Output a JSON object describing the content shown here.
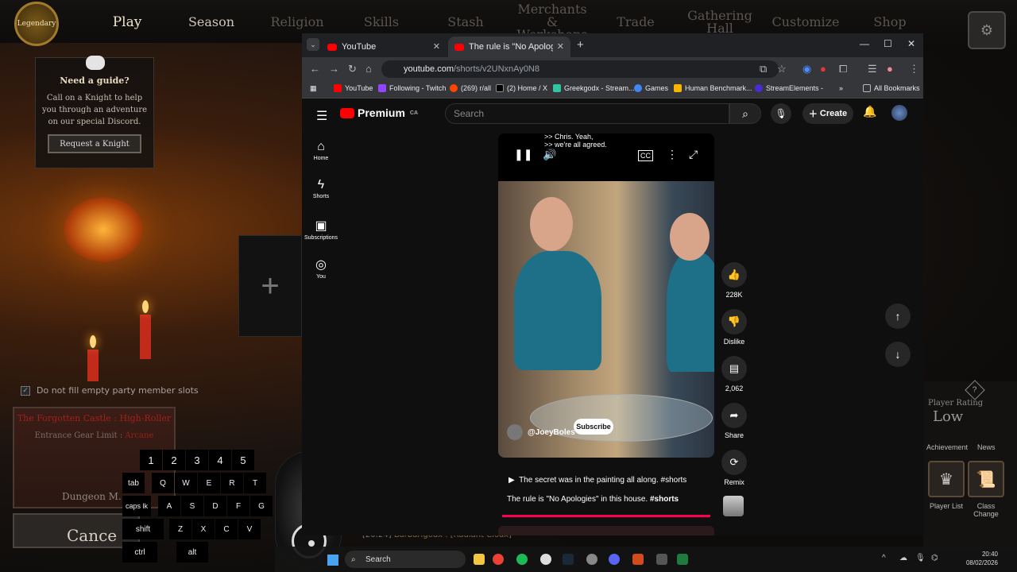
{
  "game": {
    "badge": "Legendary",
    "nav": [
      "Play",
      "Season",
      "Religion",
      "Skills",
      "Stash",
      "Merchants & Workshops",
      "Trade",
      "Gathering Hall",
      "Customize",
      "Shop"
    ],
    "guide_title": "Need a guide?",
    "guide_text": "Call on a Knight to help you through an adventure on our special Discord.",
    "guide_button": "Request a Knight",
    "checkbox_label": "Do not fill empty party member slots",
    "dungeon_title": "The Forgotten Castle : High-Roller",
    "gear_label": "Entrance Gear Limit :",
    "gear_value": "Arcane",
    "dungeon_name": "Dungeon M...",
    "cancel": "Cance",
    "chat_time": "[20:24]",
    "chat_text": "Barbarigodx : [Radiant Cloak]",
    "rating_label": "Player Rating",
    "rating_value": "Low",
    "tabs": [
      "Achievement",
      "News"
    ],
    "btn_player": "Player List",
    "btn_class": "Class Change"
  },
  "keyboard": {
    "row1": [
      "1",
      "2",
      "3",
      "4",
      "5"
    ],
    "row2": [
      "tab",
      "Q",
      "W",
      "E",
      "R",
      "T"
    ],
    "row3": [
      "caps lk",
      "A",
      "S",
      "D",
      "F",
      "G"
    ],
    "row4": [
      "shift",
      "Z",
      "X",
      "C",
      "V"
    ],
    "row5": [
      "ctrl",
      "alt"
    ]
  },
  "browser": {
    "tabs": [
      {
        "title": "YouTube"
      },
      {
        "title": "The rule is \"No Apologies\" i"
      }
    ],
    "url_domain": "youtube.com",
    "url_path": "/shorts/v2UNxnAy0N8",
    "bookmarks": [
      "YouTube",
      "Following - Twitch",
      "(269) r/all",
      "(2) Home / X",
      "Greekgodx - Stream...",
      "Games",
      "Human Benchmark...",
      "StreamElements -",
      "All Bookmarks"
    ]
  },
  "youtube": {
    "logo": "Premium",
    "region": "CA",
    "search_placeholder": "Search",
    "create": "Create",
    "sidebar": [
      "Home",
      "Shorts",
      "Subscriptions",
      "You"
    ],
    "caption_line1": ">> Chris. Yeah,",
    "caption_line2": ">> we're all agreed.",
    "channel": "@JoeyBoles",
    "subscribe": "Subscribe",
    "desc_line1": "The secret was in the painting all along. #shorts",
    "desc_line2_text": "The rule is \"No Apologies\" in this house.",
    "desc_line2_tag": "#shorts",
    "likes": "228K",
    "dislike": "Dislike",
    "comments": "2,062",
    "share": "Share",
    "remix": "Remix",
    "progress": 1.0
  },
  "taskbar": {
    "search": "Search",
    "time": "20:40",
    "date": "08/02/2026"
  }
}
